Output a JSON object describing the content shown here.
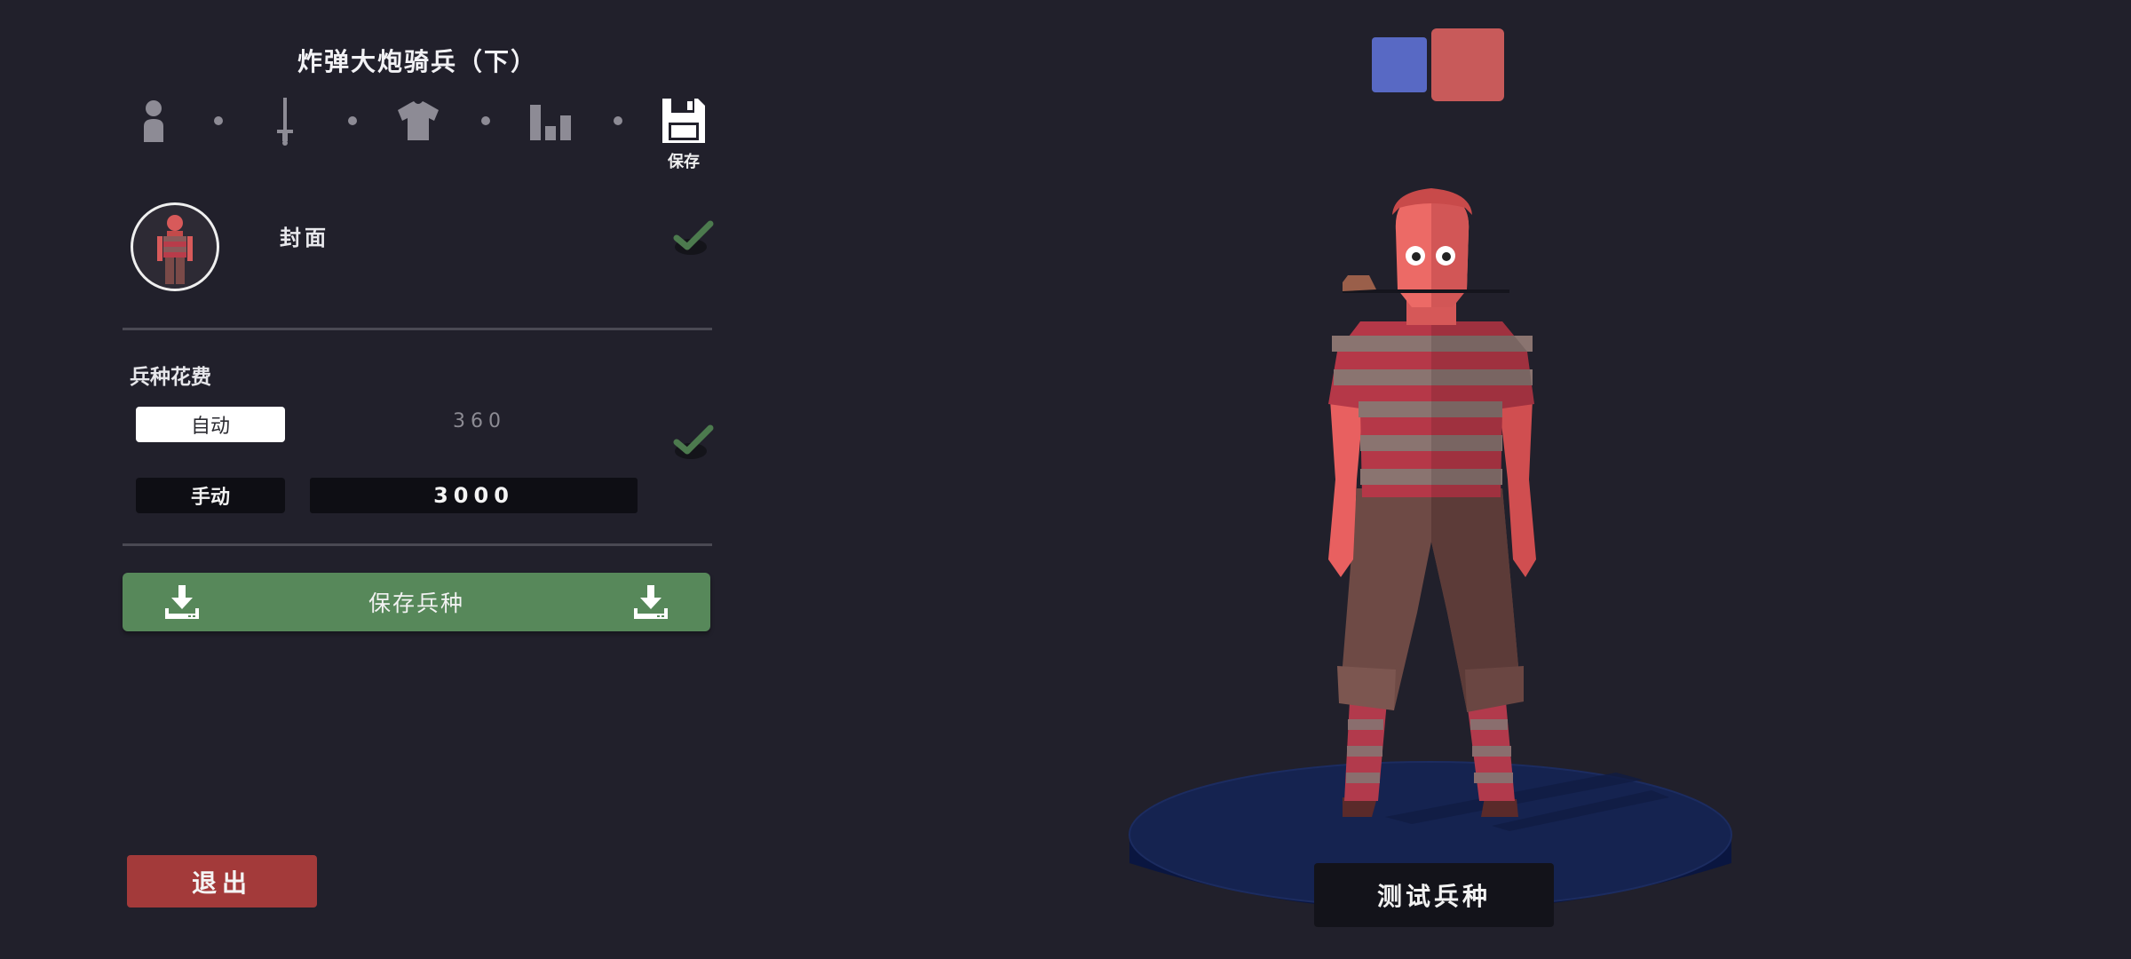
{
  "unit": {
    "title": "炸弹大炮骑兵（下）"
  },
  "steps": [
    {
      "icon": "person-icon"
    },
    {
      "icon": "sword-icon"
    },
    {
      "icon": "shirt-icon"
    },
    {
      "icon": "bars-icon"
    },
    {
      "icon": "floppy-save-icon",
      "label": "保存",
      "active": true
    }
  ],
  "cover": {
    "label": "封面",
    "confirmed": true
  },
  "cost": {
    "heading": "兵种花费",
    "auto_label": "自动",
    "auto_value": "360",
    "manual_label": "手动",
    "manual_value": "3000",
    "selected": "auto",
    "confirmed": true
  },
  "save_unit_label": "保存兵种",
  "exit_label": "退出",
  "test_unit_label": "测试兵种",
  "team_colors": {
    "blue": "#5869c4",
    "red": "#c85a5a",
    "selected": "red"
  },
  "colors": {
    "accent_green": "#57885a",
    "exit_red": "#a33a3a",
    "background": "#21202b"
  }
}
